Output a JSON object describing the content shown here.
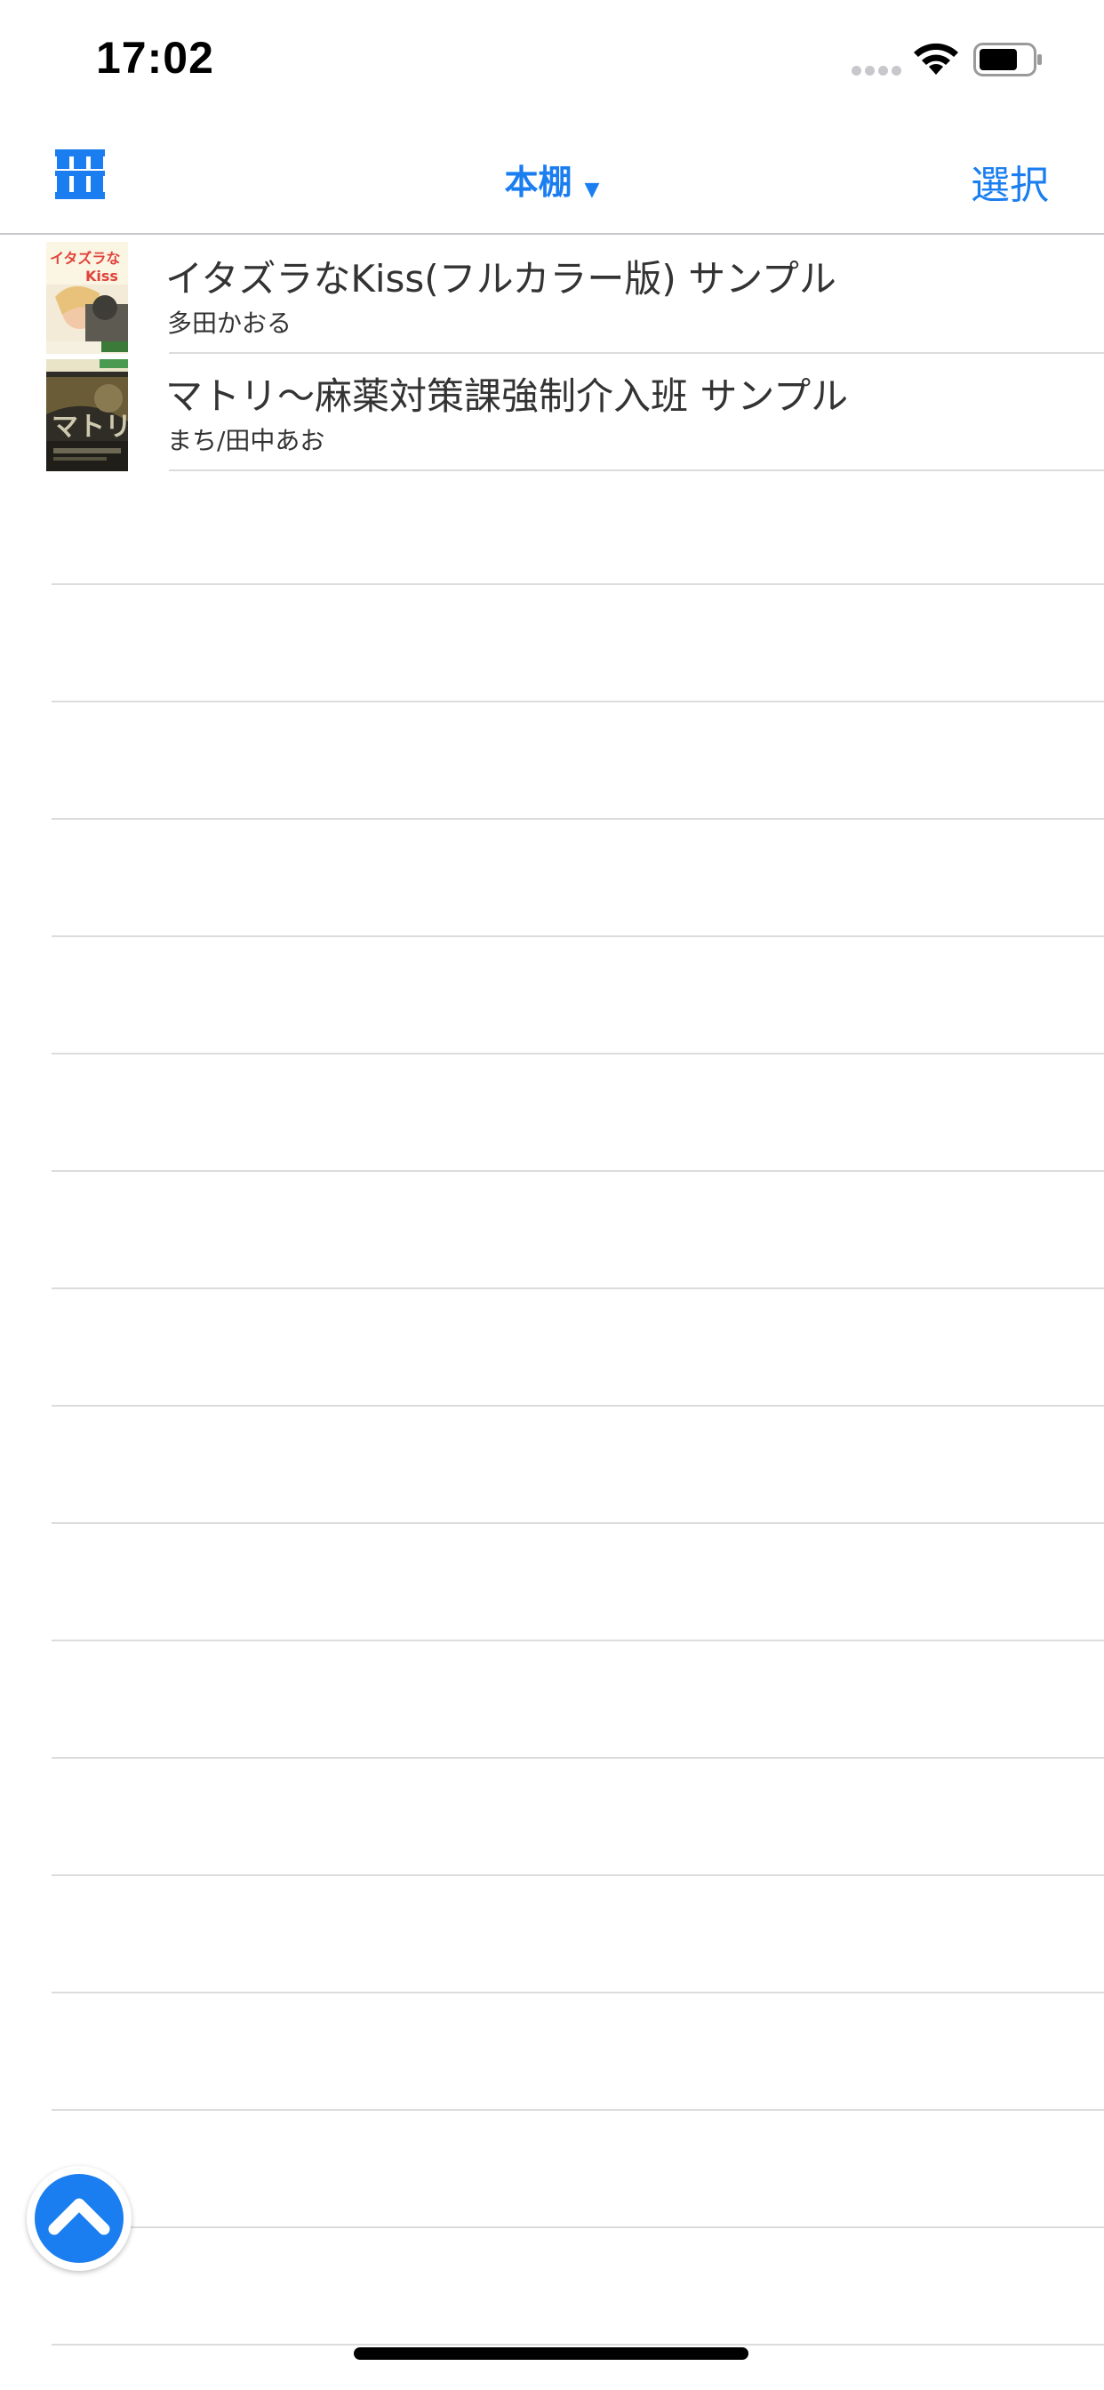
{
  "status_bar": {
    "time": "17:02"
  },
  "nav": {
    "title": "本棚",
    "caret": "▼",
    "select_label": "選択",
    "accent_color": "#1a7ef0"
  },
  "books": [
    {
      "title": "イタズラなKiss(フルカラー版) サンプル",
      "author": "多田かおる",
      "cover_label": "イタズラなKiss"
    },
    {
      "title": "マトリ〜麻薬対策課強制介入班 サンプル",
      "author": "まち/田中あお",
      "cover_label": "マトリ"
    }
  ],
  "icons": {
    "shelf": "bookshelf-icon",
    "scroll_top": "chevron-up-icon",
    "wifi": "wifi-icon",
    "battery": "battery-icon"
  }
}
